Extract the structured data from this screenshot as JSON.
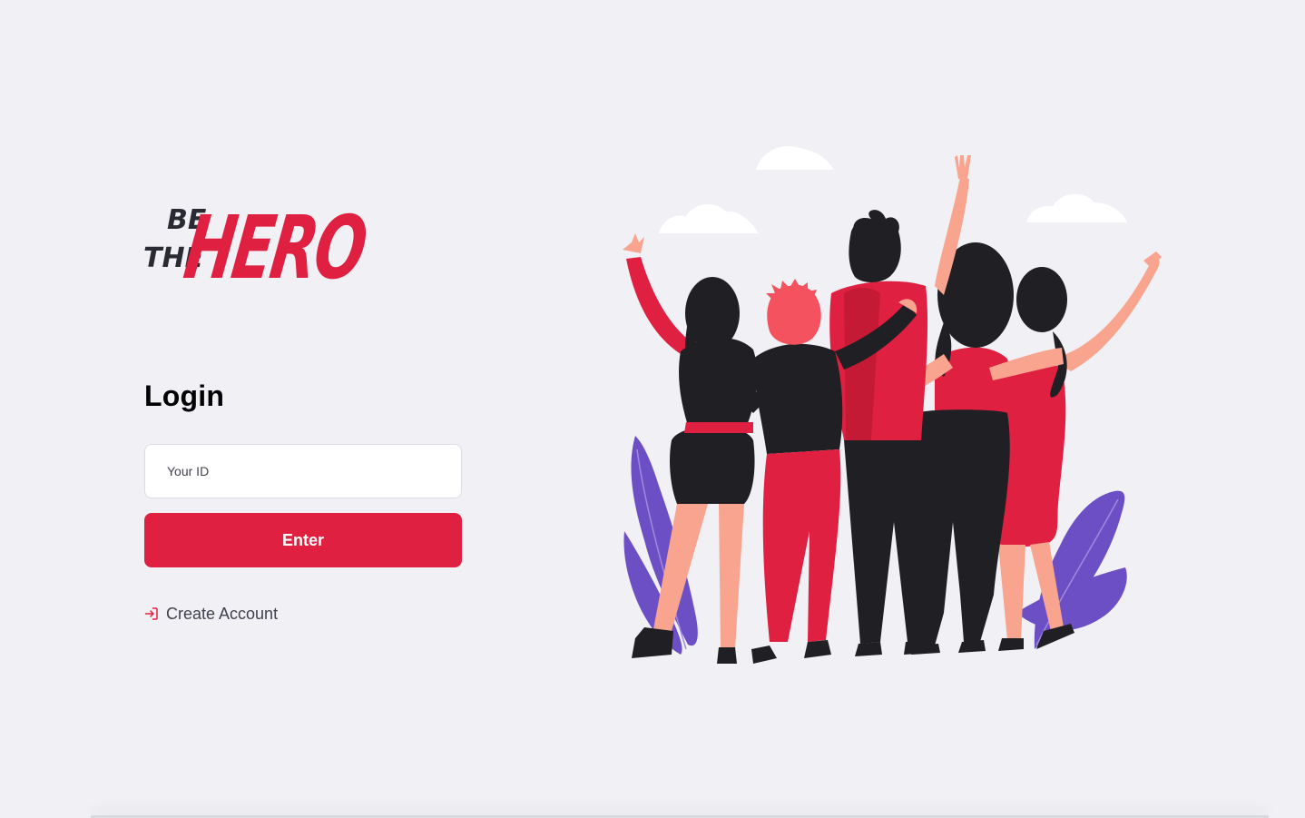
{
  "logo": {
    "line1": "BE",
    "line2": "THE",
    "word": "HERO"
  },
  "login": {
    "title": "Login",
    "id_placeholder": "Your ID",
    "id_value": "",
    "enter_label": "Enter",
    "create_account_label": "Create Account"
  },
  "icons": {
    "create_account": "log-in-icon"
  },
  "colors": {
    "accent": "#e02041",
    "background": "#f0f0f5",
    "text_dark": "#41414d",
    "illustration_purple": "#6c4fc4"
  }
}
